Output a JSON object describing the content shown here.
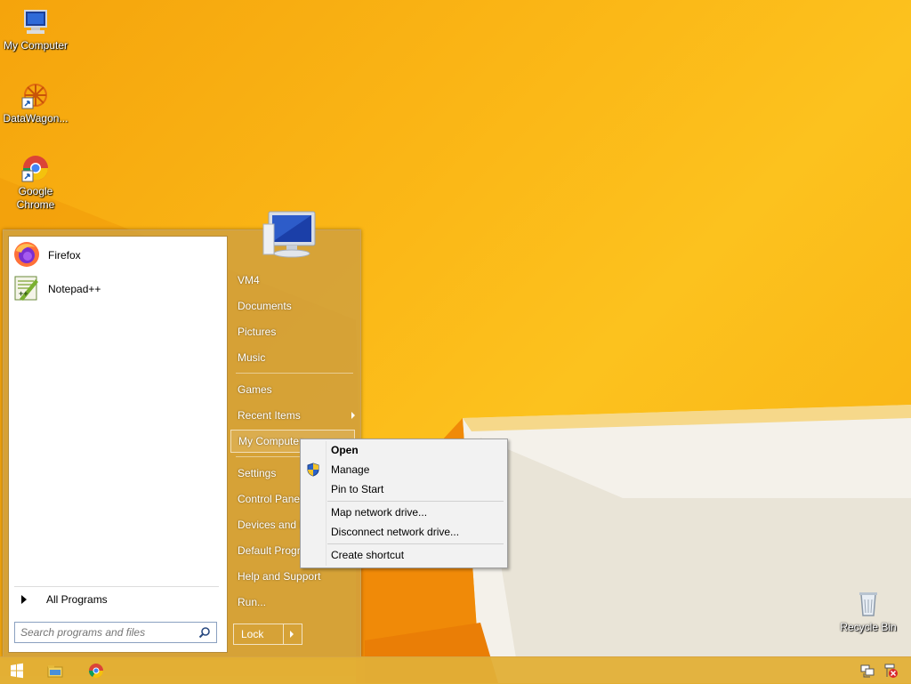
{
  "desktop": {
    "icons": [
      {
        "label": "My Computer",
        "icon": "my-computer-icon"
      },
      {
        "label": "DataWagon...",
        "icon": "datawagon-icon"
      },
      {
        "label": "Google Chrome",
        "icon": "chrome-icon"
      },
      {
        "label": "Recycle Bin",
        "icon": "recycle-bin-icon"
      }
    ]
  },
  "start_menu": {
    "pinned": [
      {
        "label": "Firefox",
        "icon": "firefox-icon"
      },
      {
        "label": "Notepad++",
        "icon": "notepadpp-icon"
      }
    ],
    "all_programs": "All Programs",
    "search_placeholder": "Search programs and files",
    "right_items": [
      {
        "label": "VM4"
      },
      {
        "label": "Documents"
      },
      {
        "label": "Pictures"
      },
      {
        "label": "Music"
      },
      {
        "label": "Games"
      },
      {
        "label": "Recent Items"
      },
      {
        "label": "My Computer"
      },
      {
        "label": "Settings"
      },
      {
        "label": "Control Panel"
      },
      {
        "label": "Devices and Printers"
      },
      {
        "label": "Default Programs"
      },
      {
        "label": "Help and Support"
      },
      {
        "label": "Run..."
      }
    ],
    "lock_label": "Lock"
  },
  "context_menu": {
    "items": [
      {
        "label": "Open",
        "bold": true
      },
      {
        "label": "Manage",
        "icon": "uac-shield-icon"
      },
      {
        "label": "Pin to Start"
      },
      {
        "label": "Map network drive..."
      },
      {
        "label": "Disconnect network drive..."
      },
      {
        "label": "Create shortcut"
      }
    ]
  },
  "taskbar": {
    "buttons": [
      "start-button-icon",
      "file-explorer-icon",
      "chrome-icon"
    ],
    "tray": [
      "network-icon",
      "action-center-icon"
    ]
  },
  "colors": {
    "wallpaper": "#f7a90e",
    "start_menu_glass": "#d2a03c",
    "taskbar": "#e1af37"
  }
}
